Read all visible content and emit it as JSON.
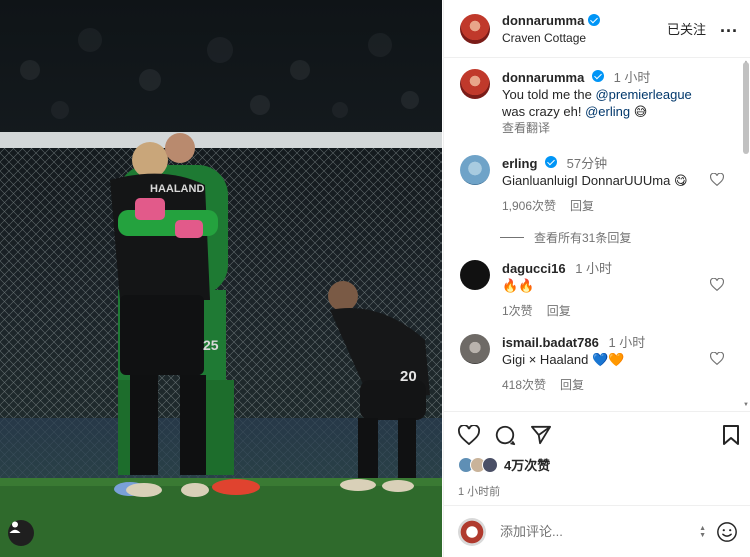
{
  "header": {
    "username": "donnarumma",
    "location": "Craven Cottage",
    "follow_state": "已关注",
    "more": "..."
  },
  "caption": {
    "username": "donnarumma",
    "time": "1 小时",
    "text_prefix": "You told me the ",
    "mention1": "@premierleague",
    "text_mid": " was crazy eh! ",
    "mention2": "@erling",
    "emoji": "😅",
    "translate": "查看翻译"
  },
  "comments": [
    {
      "username": "erling",
      "time": "57分钟",
      "text": "GianluanluigI DonnarUUUma 😋",
      "likes": "1,906次赞",
      "reply": "回复",
      "verified": true,
      "avatar_label": ""
    },
    {
      "username": "dagucci16",
      "time": "1 小时",
      "text": "🔥🔥",
      "likes": "1次赞",
      "reply": "回复",
      "verified": false,
      "avatar_label": ""
    },
    {
      "username": "ismail.badat786",
      "time": "1 小时",
      "text": "Gigi × Haaland 💙🧡",
      "likes": "418次赞",
      "reply": "回复",
      "verified": false,
      "avatar_label": ""
    }
  ],
  "view_replies": "查看所有31条回复",
  "actions": {
    "likes": "4万次赞",
    "post_time": "1 小时前"
  },
  "add_comment": {
    "placeholder": "添加评论..."
  },
  "photo": {
    "jersey_name": "HAALAND",
    "jersey_number_left": "25",
    "jersey_number_right": "20"
  },
  "colors": {
    "accent_blue": "#0095f6",
    "mention": "#00376b",
    "muted": "#737373"
  }
}
